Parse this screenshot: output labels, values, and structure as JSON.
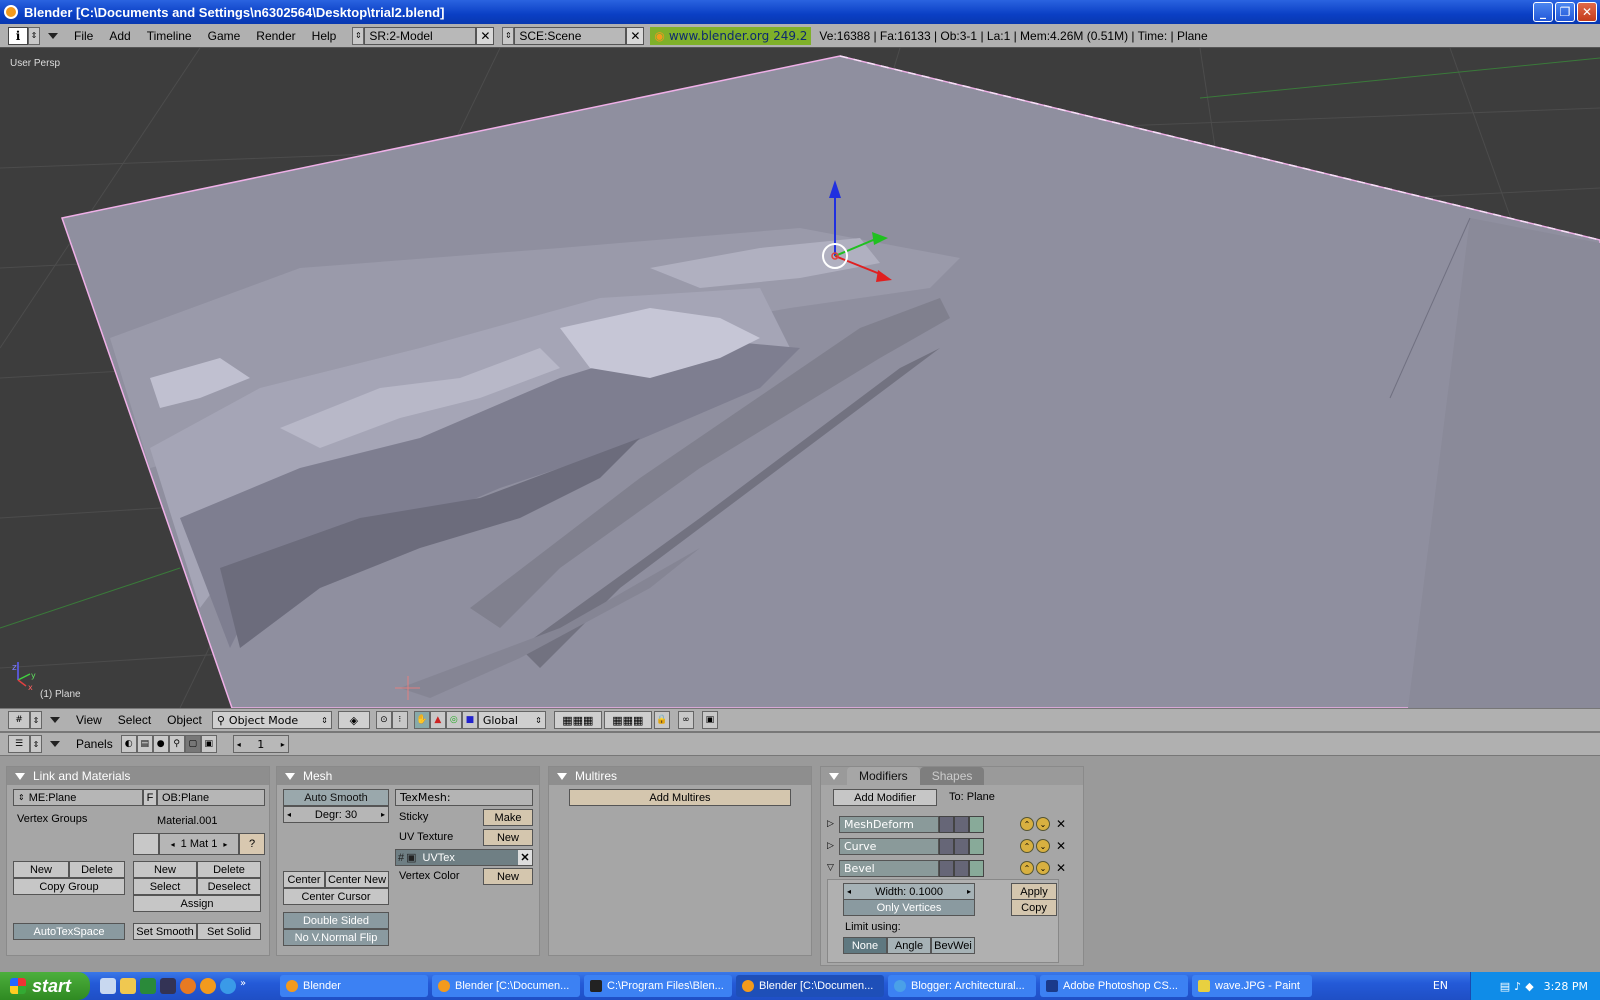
{
  "window": {
    "title": "Blender [C:\\Documents and Settings\\n6302564\\Desktop\\trial2.blend]",
    "controls": [
      "_",
      "❐",
      "✕"
    ]
  },
  "top_header": {
    "info_icon": "i",
    "menus": [
      "File",
      "Add",
      "Timeline",
      "Game",
      "Render",
      "Help"
    ],
    "screen": "SR:2-Model",
    "scene": "SCE:Scene",
    "url": "www.blender.org 249.2",
    "stats": "Ve:16388 | Fa:16133 | Ob:3-1 | La:1  | Mem:4.26M (0.51M)  | Time: | Plane"
  },
  "viewport": {
    "view_label": "User Persp",
    "object_label": "(1) Plane",
    "axis_labels": {
      "z": "z",
      "y": "y",
      "x": "x"
    }
  },
  "view_header": {
    "menus": [
      "View",
      "Select",
      "Object"
    ],
    "mode": "Object Mode",
    "orientation": "Global"
  },
  "buttons_header": {
    "label": "Panels",
    "frame": "1"
  },
  "link_materials": {
    "title": "Link and Materials",
    "mesh_name": "ME:Plane",
    "f_label": "F",
    "object_name": "OB:Plane",
    "vertex_groups": "Vertex Groups",
    "material": "Material.001",
    "mat_index": "1 Mat 1",
    "question": "?",
    "vg_new": "New",
    "vg_delete": "Delete",
    "copy_group": "Copy Group",
    "mat_new": "New",
    "mat_delete": "Delete",
    "mat_select": "Select",
    "mat_deselect": "Deselect",
    "assign": "Assign",
    "autotexspace": "AutoTexSpace",
    "set_smooth": "Set Smooth",
    "set_solid": "Set Solid"
  },
  "mesh_panel": {
    "title": "Mesh",
    "auto_smooth": "Auto Smooth",
    "degr": "Degr: 30",
    "texmesh": "TexMesh:",
    "sticky": "Sticky",
    "make": "Make",
    "uv_texture": "UV Texture",
    "uv_new": "New",
    "uvtex": "UVTex",
    "vertex_color": "Vertex Color",
    "vc_new": "New",
    "center": "Center",
    "center_new": "Center New",
    "center_cursor": "Center Cursor",
    "double_sided": "Double Sided",
    "no_vnormal_flip": "No V.Normal Flip"
  },
  "multires": {
    "title": "Multires",
    "add_multires": "Add Multires"
  },
  "modifiers": {
    "tab_modifiers": "Modifiers",
    "tab_shapes": "Shapes",
    "add_modifier": "Add Modifier",
    "to_label": "To: Plane",
    "items": [
      "MeshDeform",
      "Curve",
      "Bevel"
    ],
    "width": "Width: 0.1000",
    "only_vertices": "Only Vertices",
    "apply": "Apply",
    "copy": "Copy",
    "limit_using": "Limit using:",
    "limit_options": [
      "None",
      "Angle",
      "BevWei"
    ]
  },
  "taskbar": {
    "start": "start",
    "tasks": [
      {
        "label": "Blender",
        "active": false
      },
      {
        "label": "Blender [C:\\Documen...",
        "active": false
      },
      {
        "label": "C:\\Program Files\\Blen...",
        "active": false
      },
      {
        "label": "Blender [C:\\Documen...",
        "active": true
      },
      {
        "label": "Blogger: Architectural...",
        "active": false
      },
      {
        "label": "Adobe Photoshop CS...",
        "active": false
      },
      {
        "label": "wave.JPG - Paint",
        "active": false
      }
    ],
    "language": "EN",
    "clock": "3:28 PM"
  },
  "colors": {
    "selection_outline": "#f0b0e8",
    "axis_x": "#e02020",
    "axis_y": "#20c020",
    "axis_z": "#2030e0"
  }
}
